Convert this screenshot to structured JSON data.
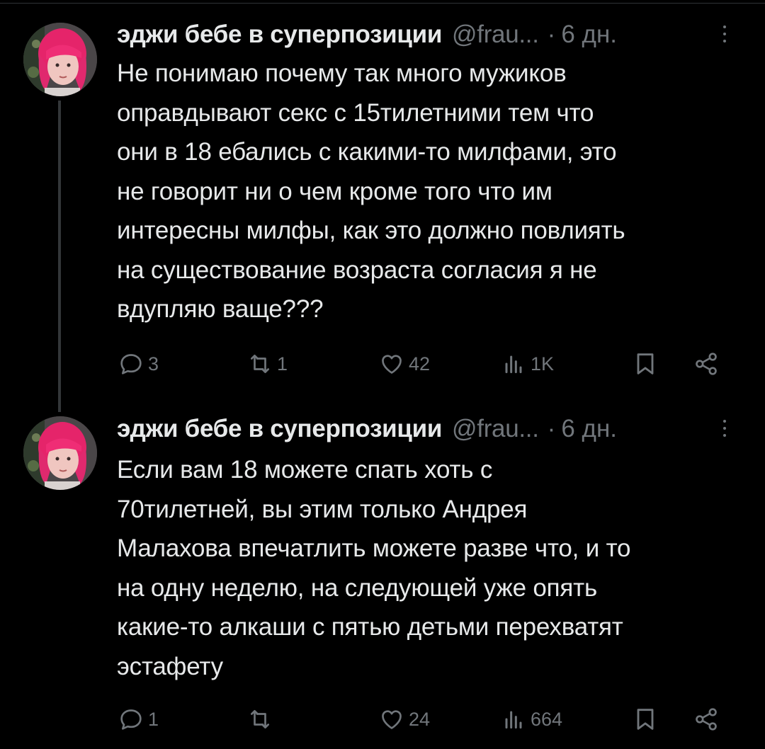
{
  "tweets": [
    {
      "author_name": "эджи бебе в суперпозиции",
      "handle": "@frau...",
      "separator": "·",
      "time": "6 дн.",
      "lines": [
        "Не понимаю почему так много мужиков",
        "оправдывают секс с 15тилетними тем что",
        "они в 18 ебались с какими-то милфами, это",
        "не говорит ни о чем кроме того что им",
        "интересны милфы, как это должно повлиять",
        "на существование возраста согласия я не",
        "вдупляю ваще???"
      ],
      "stats": {
        "replies": "3",
        "reposts": "1",
        "likes": "42",
        "views": "1K"
      }
    },
    {
      "author_name": "эджи бебе в суперпозиции",
      "handle": "@frau...",
      "separator": "·",
      "time": "6 дн.",
      "lines": [
        "Если вам 18 можете спать хоть с",
        "70тилетней, вы этим только Андрея",
        "Малахова впечатлить можете разве что, и то",
        "на одну неделю, на следующей уже опять",
        "какие-то алкаши с пятью детьми перехватят",
        "эстафету"
      ],
      "stats": {
        "replies": "1",
        "reposts": "",
        "likes": "24",
        "views": "664"
      }
    }
  ],
  "icons": {
    "reply": "reply-icon",
    "repost": "repost-icon",
    "like": "heart-icon",
    "views": "views-icon",
    "bookmark": "bookmark-icon",
    "share": "share-icon",
    "more": "more-icon"
  },
  "colors": {
    "background": "#000000",
    "text": "#e7e9ea",
    "muted": "#71767b",
    "thread_line": "#333639"
  }
}
